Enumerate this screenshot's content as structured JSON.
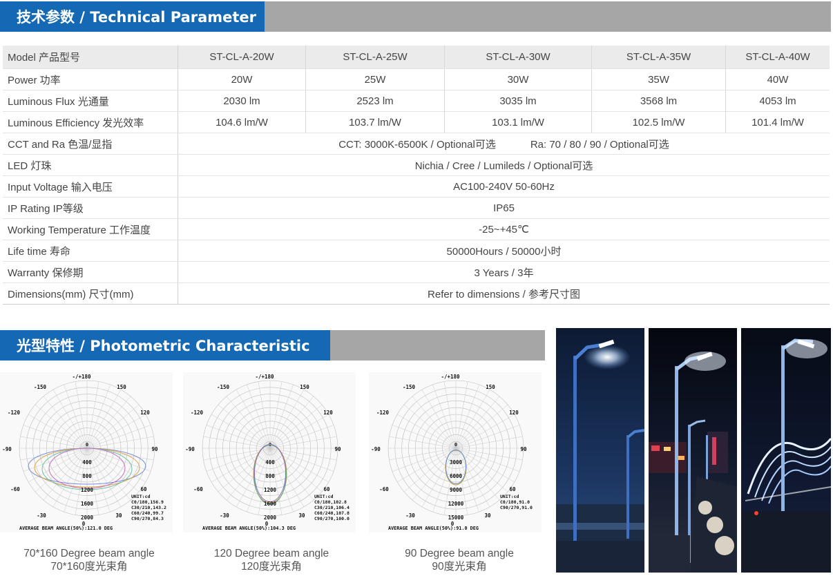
{
  "technical": {
    "title": "技术参数 / Technical Parameter",
    "header": {
      "label": "Model  产品型号",
      "models": [
        "ST-CL-A-20W",
        "ST-CL-A-25W",
        "ST-CL-A-30W",
        "ST-CL-A-35W",
        "ST-CL-A-40W"
      ]
    },
    "rows_multi": [
      {
        "label": "Power 功率",
        "values": [
          "20W",
          "25W",
          "30W",
          "35W",
          "40W"
        ]
      },
      {
        "label": "Luminous Flux  光通量",
        "values": [
          "2030 lm",
          "2523 lm",
          "3035 lm",
          "3568 lm",
          "4053 lm"
        ]
      },
      {
        "label": "Luminous Efficiency  发光效率",
        "values": [
          "104.6 lm/W",
          "103.7 lm/W",
          "103.1 lm/W",
          "102.5 lm/W",
          "101.4 lm/W"
        ]
      }
    ],
    "cct": {
      "label": "CCT  and   Ra  色温/显指",
      "cct_value": "CCT: 3000K-6500K / Optional可选",
      "ra_value": "Ra: 70 / 80 / 90 / Optional可选"
    },
    "rows_single": [
      {
        "label": "LED 灯珠",
        "value": "Nichia / Cree / Lumileds / Optional可选"
      },
      {
        "label": "Input Voltage  输入电压",
        "value": "AC100-240V 50-60Hz"
      },
      {
        "label": "IP Rating IP等级",
        "value": "IP65"
      },
      {
        "label": "Working Temperature  工作温度",
        "value": "-25~+45℃"
      },
      {
        "label": "Life time 寿命",
        "value": "50000Hours / 50000小时"
      },
      {
        "label": "Warranty 保修期",
        "value": "3 Years / 3年"
      },
      {
        "label": "Dimensions(mm)  尺寸(mm)",
        "value": "Refer to dimensions / 参考尺寸图"
      }
    ]
  },
  "photometric": {
    "title": "光型特性 / Photometric Characteristic",
    "angle_labels": {
      "top": "-/+180",
      "tl": "-150",
      "tr": "150",
      "ul": "-120",
      "ur": "120",
      "ml": "-90",
      "mr": "90",
      "ll": "-60",
      "lr": "60",
      "bl": "-30",
      "br": "30",
      "bottom": "0",
      "center": "0"
    },
    "charts": [
      {
        "rings": [
          "400",
          "800",
          "1200",
          "1600",
          "2000"
        ],
        "legend": [
          "UNIT:cd",
          "C0/180,156.9",
          "C30/210,143.2",
          "C60/240,99.7",
          "C90/270,84.3"
        ],
        "beam": "AVERAGE BEAM ANGLE(50%):121.0 DEG",
        "caption_en": "70*160 Degree beam angle",
        "caption_cn": "70*160度光束角"
      },
      {
        "rings": [
          "400",
          "800",
          "1200",
          "1600",
          "2000"
        ],
        "legend": [
          "UNIT:cd",
          "C0/180,102.8",
          "C30/210,106.4",
          "C60/240,107.8",
          "C90/270,100.0"
        ],
        "beam": "AVERAGE BEAM ANGLE(50%):104.3 DEG",
        "caption_en": "120 Degree beam angle",
        "caption_cn": "120度光束角"
      },
      {
        "rings": [
          "3000",
          "6000",
          "9000",
          "12000",
          "15000"
        ],
        "legend": [
          "UNIT:cd",
          "C0/180,91.0",
          "C90/270,91.0"
        ],
        "beam": "AVERAGE BEAM ANGLE(50%):91.0 DEG",
        "caption_en": "90 Degree beam angle",
        "caption_cn": "90度光束角"
      }
    ]
  },
  "photos": [
    "night street light on bridge",
    "night street lights with city lights",
    "night street light with illuminated arch bridge"
  ],
  "colors": {
    "accent": "#1468b4",
    "bar_gray": "#a6a6a6",
    "header_row": "#ebebeb"
  }
}
